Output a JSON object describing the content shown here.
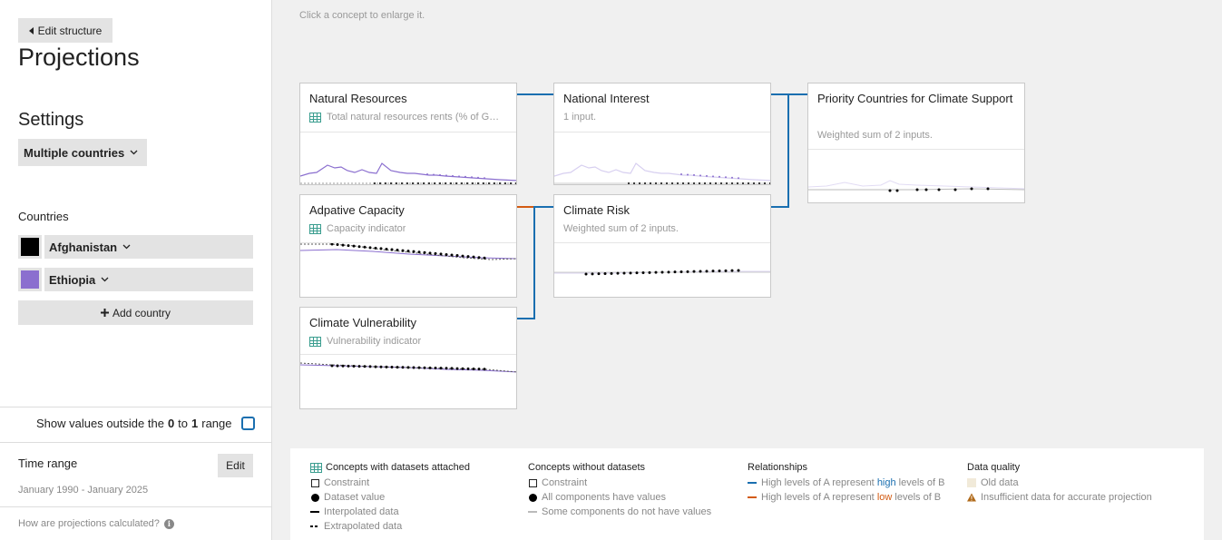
{
  "sidebar": {
    "edit_structure": "Edit structure",
    "title": "Projections",
    "settings_title": "Settings",
    "mode": "Multiple countries",
    "countries_label": "Countries",
    "countries": [
      {
        "name": "Afghanistan",
        "color": "#000000"
      },
      {
        "name": "Ethiopia",
        "color": "#8b6fcf"
      }
    ],
    "add_country": "Add country",
    "show_values": {
      "pre": "Show values outside the",
      "from": "0",
      "to_word": "to",
      "to": "1",
      "post": "range"
    },
    "time_range": {
      "title": "Time range",
      "edit": "Edit",
      "value": "January 1990 - January 2025"
    },
    "how_calculated": "How are projections calculated?"
  },
  "canvas": {
    "hint": "Click a concept to enlarge it.",
    "concepts": [
      {
        "id": "natural-resources",
        "title": "Natural Resources",
        "subtitle": "Total natural resources rents (% of G…",
        "has_dataset": true
      },
      {
        "id": "adaptive-capacity",
        "title": "Adpative Capacity",
        "subtitle": "Capacity indicator",
        "has_dataset": true
      },
      {
        "id": "climate-vulnerability",
        "title": "Climate Vulnerability",
        "subtitle": "Vulnerability indicator",
        "has_dataset": true
      },
      {
        "id": "national-interest",
        "title": "National Interest",
        "subtitle": "1 input.",
        "has_dataset": false
      },
      {
        "id": "climate-risk",
        "title": "Climate Risk",
        "subtitle": "Weighted sum of 2 inputs.",
        "has_dataset": false
      },
      {
        "id": "priority-countries",
        "title": "Priority Countries for Climate Support",
        "subtitle": "Weighted sum of 2 inputs.",
        "has_dataset": false
      }
    ],
    "relationships": [
      {
        "from": "Natural Resources",
        "to": "National Interest",
        "type": "high"
      },
      {
        "from": "Adpative Capacity",
        "to": "Climate Risk",
        "type": "low"
      },
      {
        "from": "Climate Vulnerability",
        "to": "Climate Risk",
        "type": "high"
      },
      {
        "from": "National Interest",
        "to": "Priority Countries for Climate Support",
        "type": "high"
      },
      {
        "from": "Climate Risk",
        "to": "Priority Countries for Climate Support",
        "type": "high"
      }
    ],
    "link_colors": {
      "high": "#1a6fb0",
      "low": "#d35b12"
    }
  },
  "legend": {
    "with_datasets": {
      "title": "Concepts with datasets attached",
      "items": [
        "Constraint",
        "Dataset value",
        "Interpolated data",
        "Extrapolated data"
      ]
    },
    "without_datasets": {
      "title": "Concepts without datasets",
      "items": [
        "Constraint",
        "All components have values",
        "Some components do not have values"
      ]
    },
    "relationships": {
      "title": "Relationships",
      "high": {
        "pre": "High levels of A represent",
        "word": "high",
        "post": "levels of B"
      },
      "low": {
        "pre": "High levels of A represent",
        "word": "low",
        "post": "levels of B"
      }
    },
    "data_quality": {
      "title": "Data quality",
      "items": [
        "Old data",
        "Insufficient data for accurate projection"
      ]
    }
  }
}
